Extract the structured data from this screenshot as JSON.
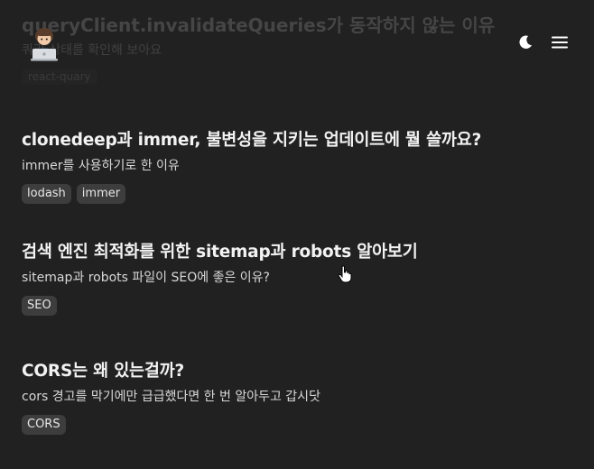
{
  "header": {
    "avatar_icon": "laptop-avatar-icon",
    "theme_icon": "moon-icon",
    "menu_icon": "hamburger-menu-icon"
  },
  "faded_post": {
    "title": "queryClient.invalidateQueries가 동작하지 않는 이유",
    "description": "쿼리 상태를 확인해 보아요",
    "tags": [
      "react-quary"
    ]
  },
  "posts": [
    {
      "title": "clonedeep과 immer, 불변성을 지키는 업데이트에 뭘 쓸까요?",
      "description": "immer를 사용하기로 한 이유",
      "tags": [
        "lodash",
        "immer"
      ]
    },
    {
      "title": "검색 엔진 최적화를 위한 sitemap과 robots 알아보기",
      "description": "sitemap과 robots 파일이 SEO에 좋은 이유?",
      "tags": [
        "SEO"
      ]
    },
    {
      "title": "CORS는 왜 있는걸까?",
      "description": "cors 경고를 막기에만 급급했다면 한 번 알아두고 갑시닷",
      "tags": [
        "CORS"
      ]
    }
  ],
  "colors": {
    "background": "#212121",
    "title": "#f2f2f2",
    "description": "#d8d8d8",
    "tag_background": "#3d3d3d"
  }
}
